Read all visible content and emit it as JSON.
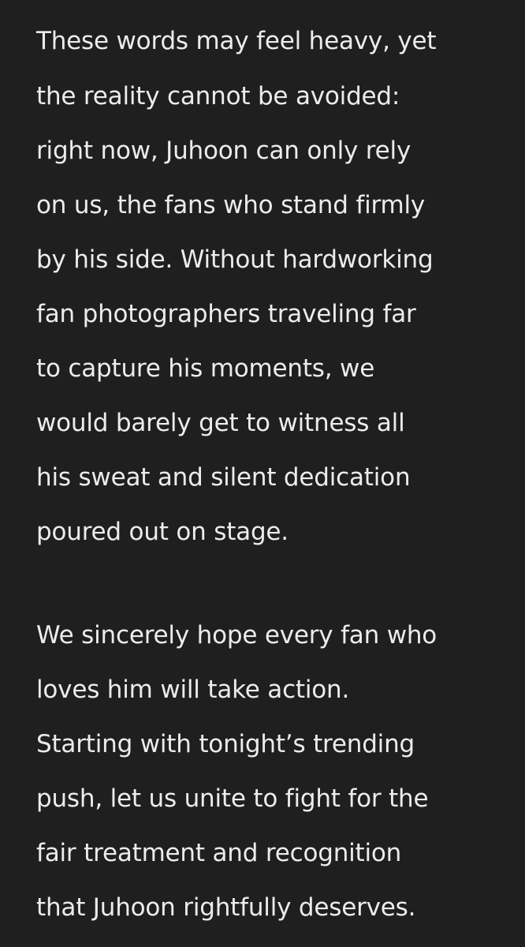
{
  "paragraphs": [
    {
      "lines": [
        "These words may feel heavy, yet",
        "the reality cannot be avoided:",
        "right now, Juhoon can only rely",
        "on us, the fans who stand firmly",
        "by his side. Without hardworking",
        "fan photographers traveling far",
        "to capture his moments, we",
        "would barely get to witness all",
        "his sweat and silent dedication",
        "poured out on stage."
      ]
    },
    {
      "lines": [
        "We sincerely hope every fan who",
        "loves him will take action.",
        "Starting with tonight’s trending",
        "push, let us unite to fight for the",
        "fair treatment and recognition",
        "that Juhoon rightfully deserves."
      ]
    }
  ]
}
